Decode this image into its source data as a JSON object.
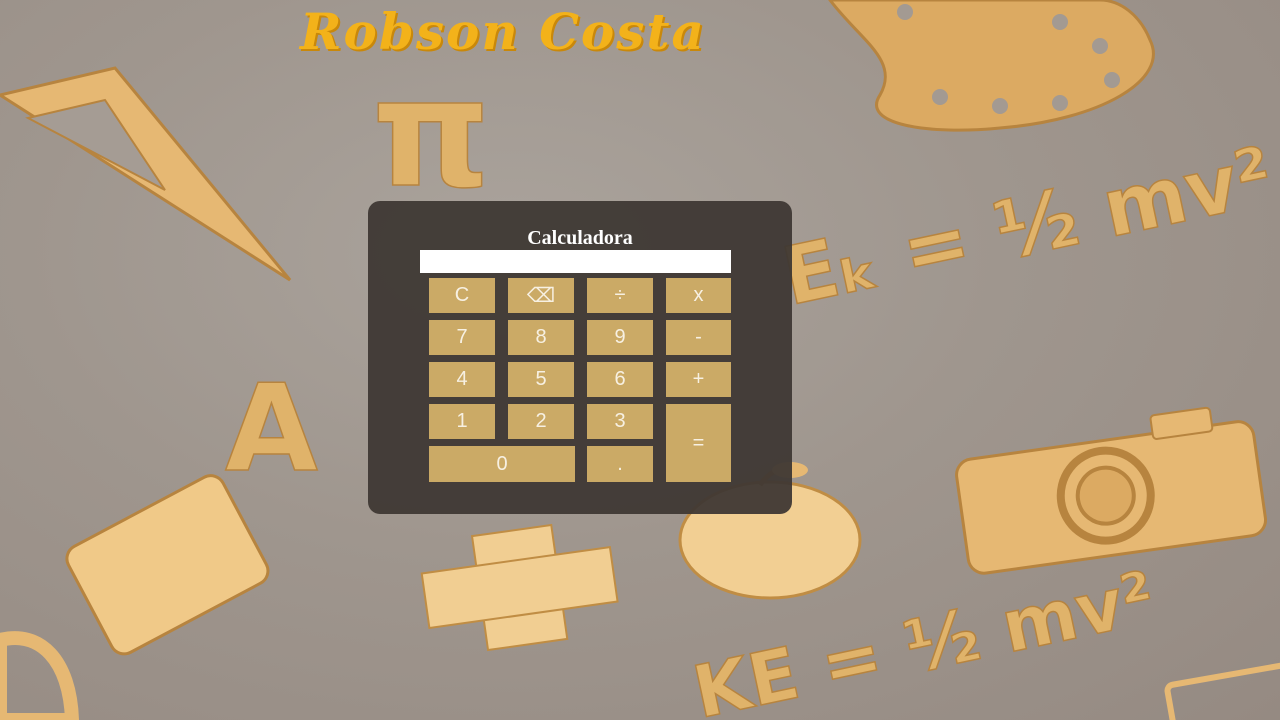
{
  "brand": {
    "name": "Robson Costa"
  },
  "background": {
    "formula_upper": "Eₖ = ½ mv²",
    "formula_lower": "KE = ½ mv²",
    "letter": "A",
    "pi": "π"
  },
  "calculator": {
    "title": "Calculadora",
    "display_value": "",
    "keys": {
      "clear": "C",
      "backspace": "⌫",
      "divide": "÷",
      "multiply": "x",
      "seven": "7",
      "eight": "8",
      "nine": "9",
      "minus": "-",
      "four": "4",
      "five": "5",
      "six": "6",
      "plus": "+",
      "one": "1",
      "two": "2",
      "three": "3",
      "equals": "=",
      "zero": "0",
      "decimal": "."
    }
  },
  "colors": {
    "brand": "#f3b21a",
    "panel": "#3e3733",
    "key": "#cbaa66",
    "key_text": "#f7f0e2",
    "background": "#9f968e"
  }
}
